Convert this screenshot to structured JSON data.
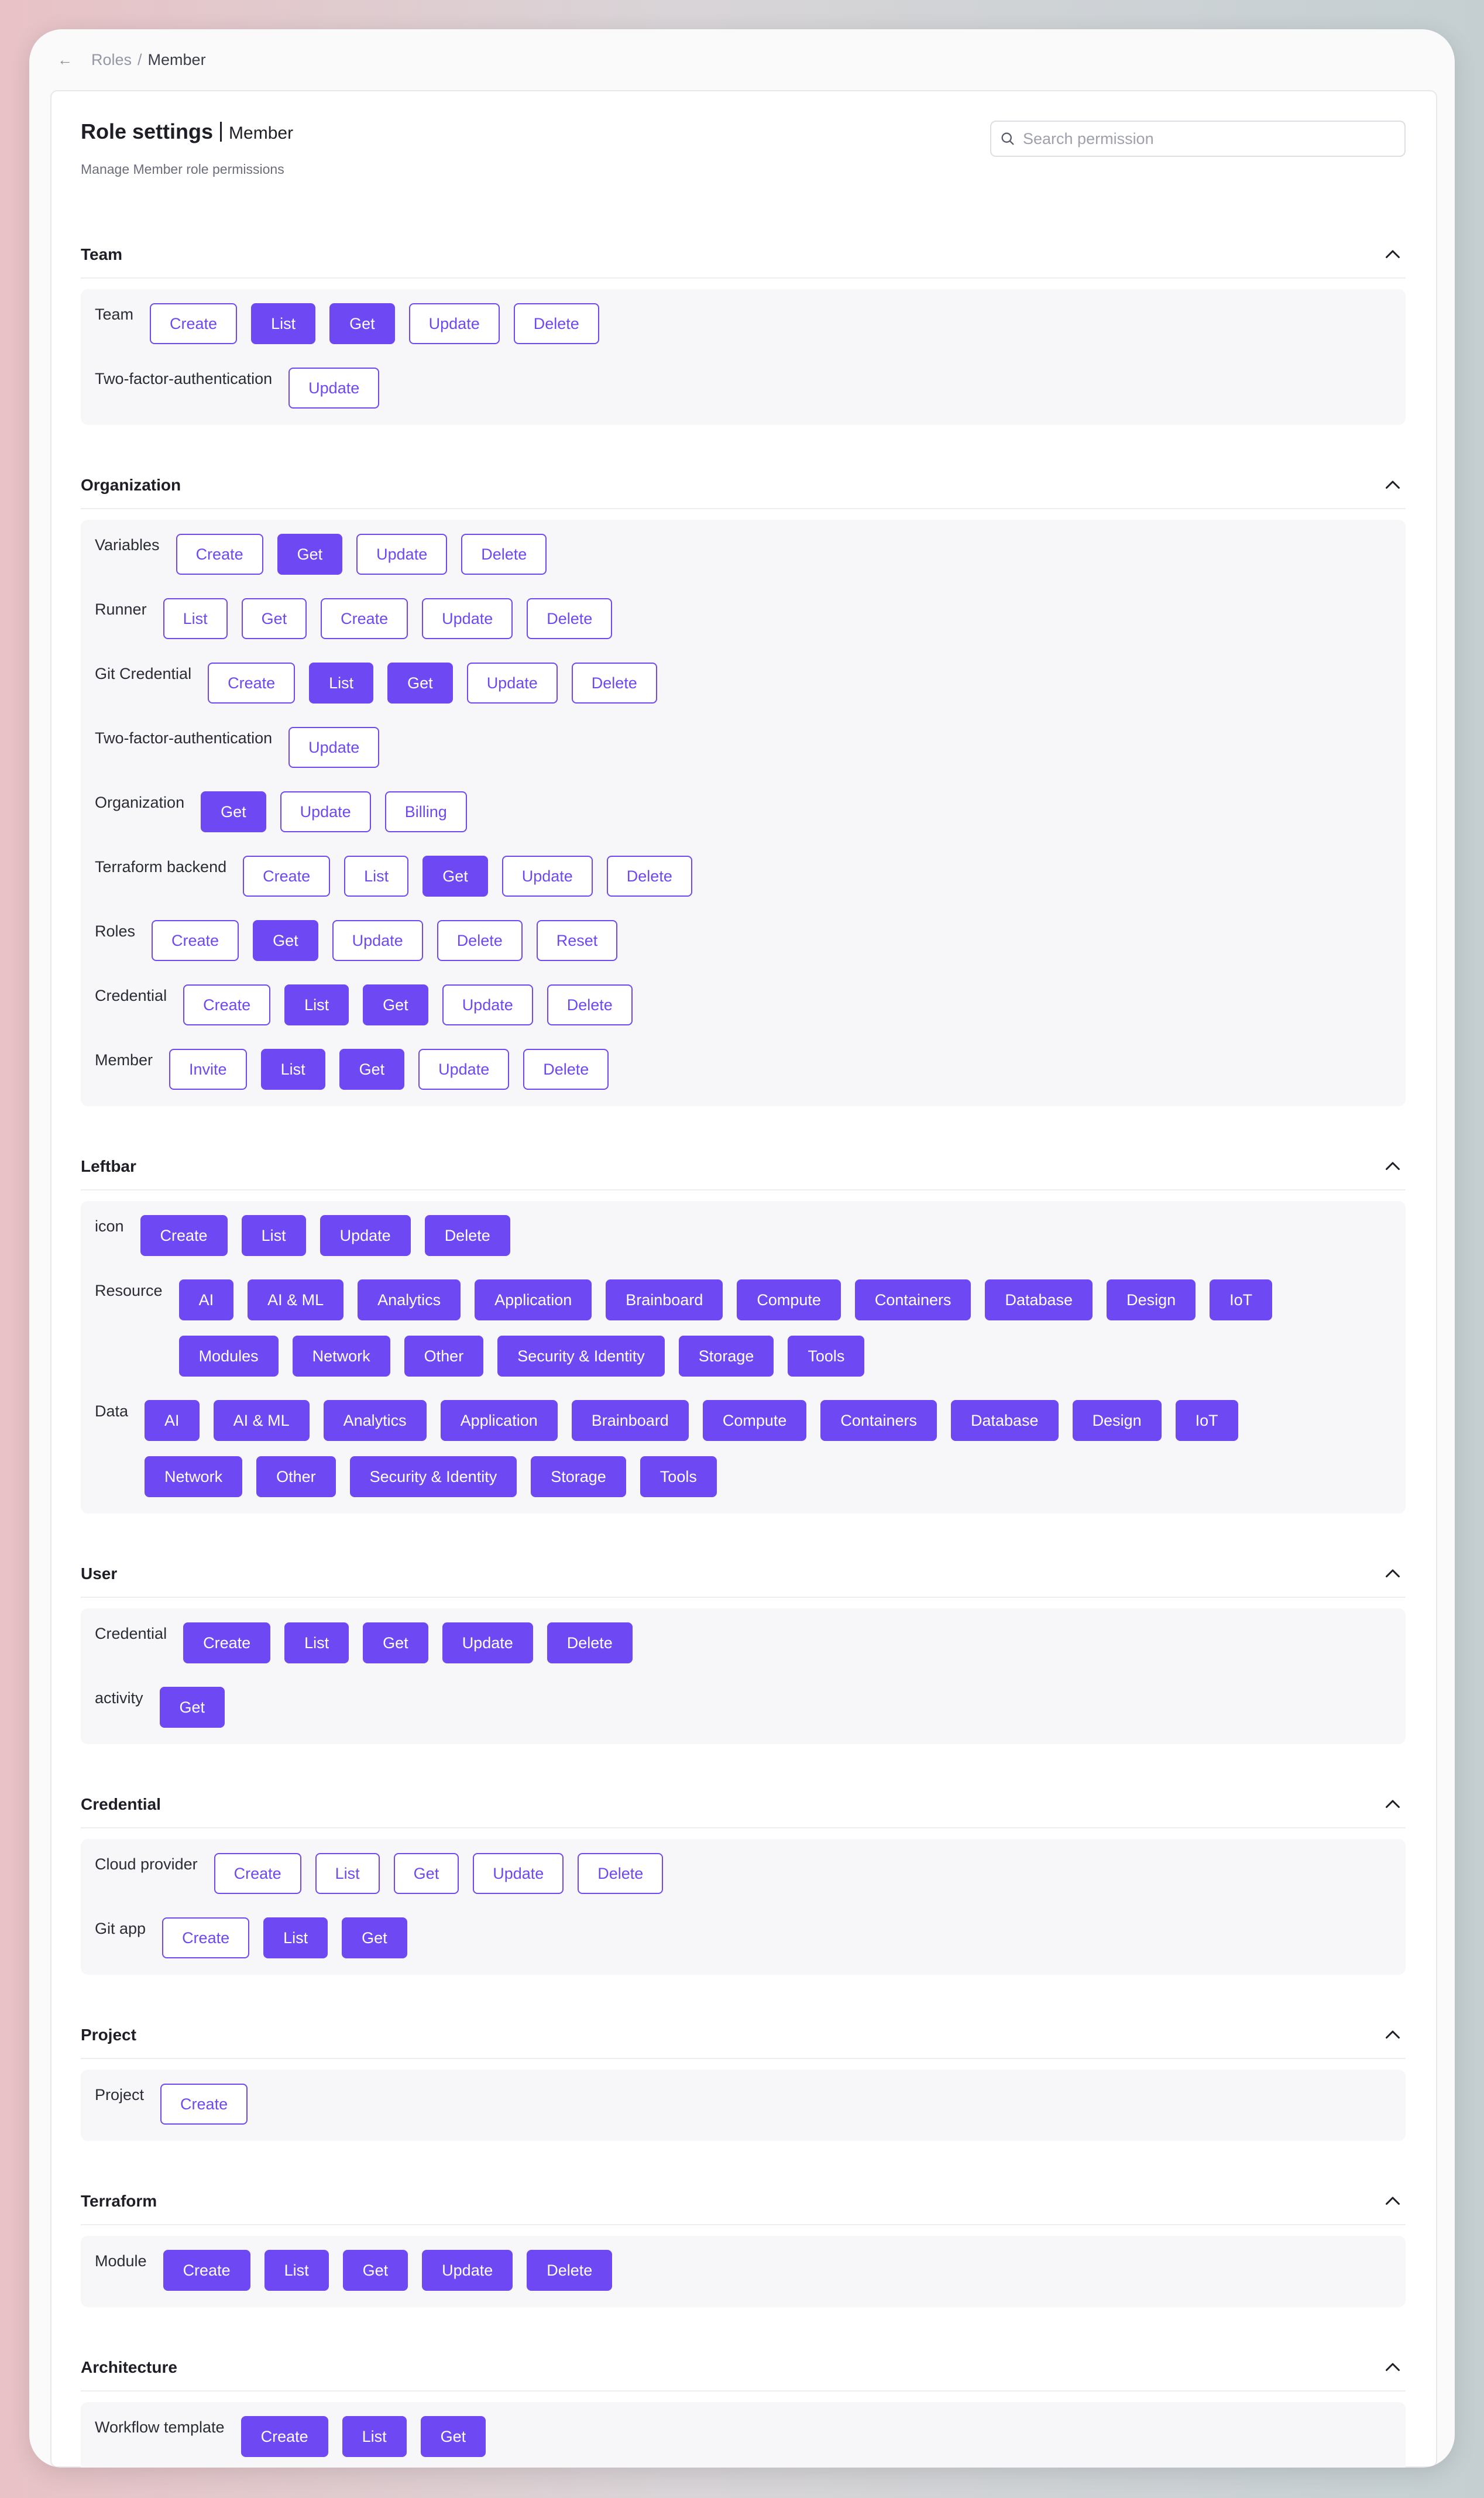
{
  "breadcrumb": {
    "parent": "Roles",
    "separator": "/",
    "current": "Member"
  },
  "header": {
    "title": "Role settings",
    "role": "Member",
    "subtitle": "Manage Member role permissions",
    "search_placeholder": "Search permission"
  },
  "colors": {
    "accent": "#6e48f2",
    "panel": "#f7f7f9"
  },
  "sections": [
    {
      "title": "Team",
      "rows": [
        {
          "label": "Team",
          "buttons": [
            {
              "label": "Create",
              "on": false
            },
            {
              "label": "List",
              "on": true
            },
            {
              "label": "Get",
              "on": true
            },
            {
              "label": "Update",
              "on": false
            },
            {
              "label": "Delete",
              "on": false
            }
          ]
        },
        {
          "label": "Two-factor-authentication",
          "buttons": [
            {
              "label": "Update",
              "on": false
            }
          ]
        }
      ]
    },
    {
      "title": "Organization",
      "rows": [
        {
          "label": "Variables",
          "buttons": [
            {
              "label": "Create",
              "on": false
            },
            {
              "label": "Get",
              "on": true
            },
            {
              "label": "Update",
              "on": false
            },
            {
              "label": "Delete",
              "on": false
            }
          ]
        },
        {
          "label": "Runner",
          "buttons": [
            {
              "label": "List",
              "on": false
            },
            {
              "label": "Get",
              "on": false
            },
            {
              "label": "Create",
              "on": false
            },
            {
              "label": "Update",
              "on": false
            },
            {
              "label": "Delete",
              "on": false
            }
          ]
        },
        {
          "label": "Git Credential",
          "buttons": [
            {
              "label": "Create",
              "on": false
            },
            {
              "label": "List",
              "on": true
            },
            {
              "label": "Get",
              "on": true
            },
            {
              "label": "Update",
              "on": false
            },
            {
              "label": "Delete",
              "on": false
            }
          ]
        },
        {
          "label": "Two-factor-authentication",
          "buttons": [
            {
              "label": "Update",
              "on": false
            }
          ]
        },
        {
          "label": "Organization",
          "buttons": [
            {
              "label": "Get",
              "on": true
            },
            {
              "label": "Update",
              "on": false
            },
            {
              "label": "Billing",
              "on": false
            }
          ]
        },
        {
          "label": "Terraform backend",
          "buttons": [
            {
              "label": "Create",
              "on": false
            },
            {
              "label": "List",
              "on": false
            },
            {
              "label": "Get",
              "on": true
            },
            {
              "label": "Update",
              "on": false
            },
            {
              "label": "Delete",
              "on": false
            }
          ]
        },
        {
          "label": "Roles",
          "buttons": [
            {
              "label": "Create",
              "on": false
            },
            {
              "label": "Get",
              "on": true
            },
            {
              "label": "Update",
              "on": false
            },
            {
              "label": "Delete",
              "on": false
            },
            {
              "label": "Reset",
              "on": false
            }
          ]
        },
        {
          "label": "Credential",
          "buttons": [
            {
              "label": "Create",
              "on": false
            },
            {
              "label": "List",
              "on": true
            },
            {
              "label": "Get",
              "on": true
            },
            {
              "label": "Update",
              "on": false
            },
            {
              "label": "Delete",
              "on": false
            }
          ]
        },
        {
          "label": "Member",
          "buttons": [
            {
              "label": "Invite",
              "on": false
            },
            {
              "label": "List",
              "on": true
            },
            {
              "label": "Get",
              "on": true
            },
            {
              "label": "Update",
              "on": false
            },
            {
              "label": "Delete",
              "on": false
            }
          ]
        }
      ]
    },
    {
      "title": "Leftbar",
      "rows": [
        {
          "label": "icon",
          "buttons": [
            {
              "label": "Create",
              "on": true
            },
            {
              "label": "List",
              "on": true
            },
            {
              "label": "Update",
              "on": true
            },
            {
              "label": "Delete",
              "on": true
            }
          ]
        },
        {
          "label": "Resource",
          "wrap": true,
          "buttons": [
            {
              "label": "AI",
              "on": true
            },
            {
              "label": "AI & ML",
              "on": true
            },
            {
              "label": "Analytics",
              "on": true
            },
            {
              "label": "Application",
              "on": true
            },
            {
              "label": "Brainboard",
              "on": true
            },
            {
              "label": "Compute",
              "on": true
            },
            {
              "label": "Containers",
              "on": true
            },
            {
              "label": "Database",
              "on": true
            },
            {
              "label": "Design",
              "on": true
            },
            {
              "label": "IoT",
              "on": true
            },
            {
              "label": "Modules",
              "on": true
            },
            {
              "label": "Network",
              "on": true
            },
            {
              "label": "Other",
              "on": true
            },
            {
              "label": "Security & Identity",
              "on": true
            },
            {
              "label": "Storage",
              "on": true
            },
            {
              "label": "Tools",
              "on": true
            }
          ]
        },
        {
          "label": "Data",
          "wrap": true,
          "buttons": [
            {
              "label": "AI",
              "on": true
            },
            {
              "label": "AI & ML",
              "on": true
            },
            {
              "label": "Analytics",
              "on": true
            },
            {
              "label": "Application",
              "on": true
            },
            {
              "label": "Brainboard",
              "on": true
            },
            {
              "label": "Compute",
              "on": true
            },
            {
              "label": "Containers",
              "on": true
            },
            {
              "label": "Database",
              "on": true
            },
            {
              "label": "Design",
              "on": true
            },
            {
              "label": "IoT",
              "on": true
            },
            {
              "label": "Network",
              "on": true
            },
            {
              "label": "Other",
              "on": true
            },
            {
              "label": "Security & Identity",
              "on": true
            },
            {
              "label": "Storage",
              "on": true
            },
            {
              "label": "Tools",
              "on": true
            }
          ]
        }
      ]
    },
    {
      "title": "User",
      "rows": [
        {
          "label": "Credential",
          "buttons": [
            {
              "label": "Create",
              "on": true
            },
            {
              "label": "List",
              "on": true
            },
            {
              "label": "Get",
              "on": true
            },
            {
              "label": "Update",
              "on": true
            },
            {
              "label": "Delete",
              "on": true
            }
          ]
        },
        {
          "label": "activity",
          "buttons": [
            {
              "label": "Get",
              "on": true
            }
          ]
        }
      ]
    },
    {
      "title": "Credential",
      "rows": [
        {
          "label": "Cloud provider",
          "buttons": [
            {
              "label": "Create",
              "on": false
            },
            {
              "label": "List",
              "on": false
            },
            {
              "label": "Get",
              "on": false
            },
            {
              "label": "Update",
              "on": false
            },
            {
              "label": "Delete",
              "on": false
            }
          ]
        },
        {
          "label": "Git app",
          "buttons": [
            {
              "label": "Create",
              "on": false
            },
            {
              "label": "List",
              "on": true
            },
            {
              "label": "Get",
              "on": true
            }
          ]
        }
      ]
    },
    {
      "title": "Project",
      "rows": [
        {
          "label": "Project",
          "buttons": [
            {
              "label": "Create",
              "on": false
            }
          ]
        }
      ]
    },
    {
      "title": "Terraform",
      "rows": [
        {
          "label": "Module",
          "buttons": [
            {
              "label": "Create",
              "on": true
            },
            {
              "label": "List",
              "on": true
            },
            {
              "label": "Get",
              "on": true
            },
            {
              "label": "Update",
              "on": true
            },
            {
              "label": "Delete",
              "on": true
            }
          ]
        }
      ]
    },
    {
      "title": "Architecture",
      "rows": [
        {
          "label": "Workflow template",
          "buttons": [
            {
              "label": "Create",
              "on": true
            },
            {
              "label": "List",
              "on": true
            },
            {
              "label": "Get",
              "on": true
            }
          ]
        }
      ]
    }
  ]
}
